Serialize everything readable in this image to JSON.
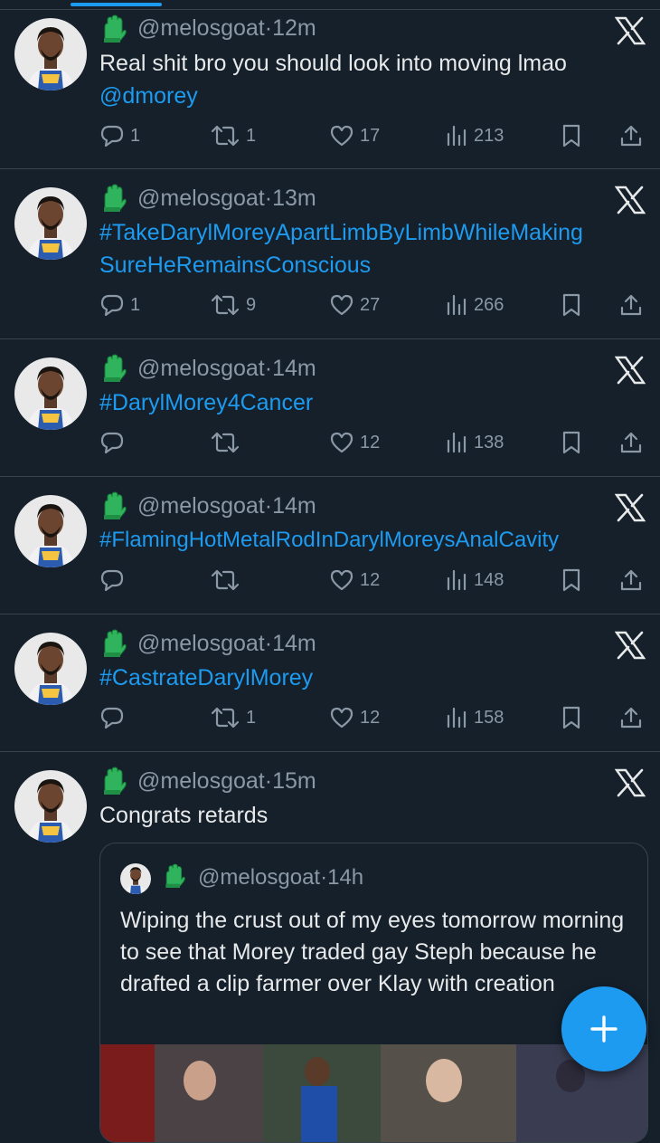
{
  "tweets": [
    {
      "handle": "@melosgoat",
      "time": "12m",
      "text": "Real shit bro you should look into moving lmao",
      "mention": "@dmorey",
      "replies": "1",
      "retweets": "1",
      "likes": "17",
      "views": "213"
    },
    {
      "handle": "@melosgoat",
      "time": "13m",
      "text": "#TakeDarylMoreyApartLimbByLimbWhileMaking SureHeRemainsConscious",
      "replies": "1",
      "retweets": "9",
      "likes": "27",
      "views": "266"
    },
    {
      "handle": "@melosgoat",
      "time": "14m",
      "text": "#DarylMorey4Cancer",
      "replies": "",
      "retweets": "",
      "likes": "12",
      "views": "138"
    },
    {
      "handle": "@melosgoat",
      "time": "14m",
      "text": "#FlamingHotMetalRodInDarylMoreysAnalCavity",
      "replies": "",
      "retweets": "",
      "likes": "12",
      "views": "148"
    },
    {
      "handle": "@melosgoat",
      "time": "14m",
      "text": "#CastrateDarylMorey",
      "replies": "",
      "retweets": "1",
      "likes": "12",
      "views": "158"
    },
    {
      "handle": "@melosgoat",
      "time": "15m",
      "text": "Congrats retards",
      "quote": {
        "handle": "@melosgoat",
        "time": "14h",
        "text": "Wiping the crust out of my eyes tomorrow morning to see that Morey traded gay Steph because he drafted a clip farmer over Klay with creation"
      }
    }
  ],
  "separator": "·",
  "icons": {
    "reply": "reply-icon",
    "retweet": "retweet-icon",
    "like": "heart-icon",
    "views": "views-icon",
    "bookmark": "bookmark-icon",
    "share": "share-icon",
    "brand": "x-logo-icon",
    "compose": "compose-plus-icon",
    "emoji": "green-glove-emoji"
  },
  "colors": {
    "background": "#15202b",
    "accent": "#1d9bf0",
    "text": "#e7e9ea",
    "muted": "#8b98a5",
    "border": "#38444d"
  }
}
